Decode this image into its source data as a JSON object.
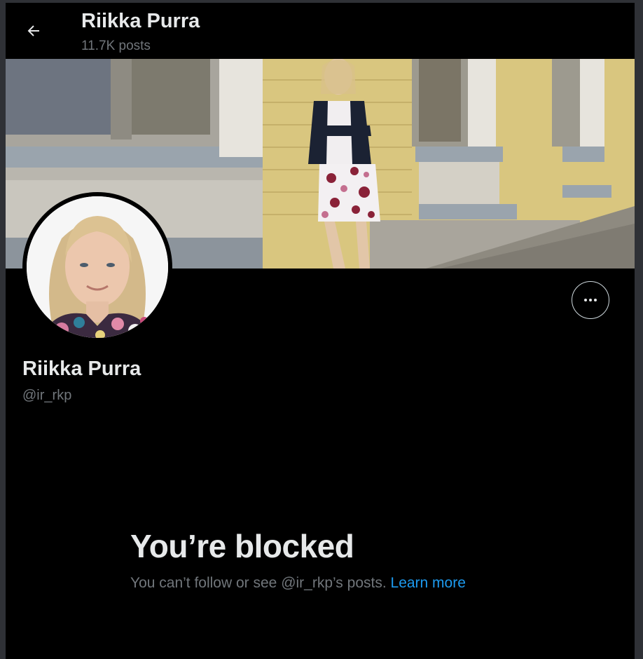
{
  "header": {
    "name": "Riikka Purra",
    "post_count": "11.7K posts"
  },
  "profile": {
    "name": "Riikka Purra",
    "handle": "@ir_rkp"
  },
  "blocked": {
    "title": "You’re blocked",
    "message": "You can’t follow or see @ir_rkp’s posts.",
    "link_label": "Learn more"
  },
  "icons": {
    "back": "arrow-left-icon",
    "more": "more-horizontal-icon"
  },
  "colors": {
    "background": "#000000",
    "text_primary": "#e7e9ea",
    "text_secondary": "#71767b",
    "link": "#1d9bf0"
  }
}
